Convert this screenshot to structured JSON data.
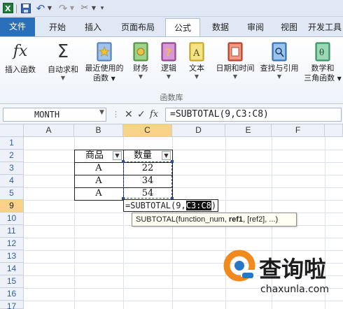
{
  "quick_access": {
    "separator": "|"
  },
  "tabs": [
    {
      "label": "文件"
    },
    {
      "label": "开始"
    },
    {
      "label": "插入"
    },
    {
      "label": "页面布局"
    },
    {
      "label": "公式"
    },
    {
      "label": "数据"
    },
    {
      "label": "审阅"
    },
    {
      "label": "视图"
    },
    {
      "label": "开发工具"
    }
  ],
  "ribbon": {
    "buttons": [
      {
        "label": "插入函数",
        "icon": "fx-icon"
      },
      {
        "label": "自动求和",
        "icon": "sigma-icon"
      },
      {
        "label": "最近使用的",
        "label2": "函数",
        "icon": "book-star-icon"
      },
      {
        "label": "财务",
        "icon": "book-finance-icon"
      },
      {
        "label": "逻辑",
        "icon": "book-question-icon"
      },
      {
        "label": "文本",
        "icon": "book-text-icon"
      },
      {
        "label": "日期和时间",
        "icon": "book-calendar-icon"
      },
      {
        "label": "查找与引用",
        "icon": "book-lookup-icon"
      },
      {
        "label": "数学和",
        "label2": "三角函数",
        "icon": "book-theta-icon"
      }
    ],
    "group_label": "函数库",
    "fx_glyph": "fx",
    "sigma_glyph": "Σ",
    "theta_glyph": "θ"
  },
  "formula_bar": {
    "name_box": "MONTH",
    "cancel_glyph": "✕",
    "enter_glyph": "✓",
    "fx_label": "fx",
    "formula": "=SUBTOTAL(9,C3:C8)"
  },
  "columns": [
    "A",
    "B",
    "C",
    "D",
    "E",
    "F"
  ],
  "rows": [
    "1",
    "2",
    "3",
    "4",
    "5",
    "9",
    "10",
    "11",
    "12",
    "13",
    "14",
    "15",
    "16",
    "17"
  ],
  "table": {
    "headers": [
      "商品",
      "数量"
    ],
    "rows": [
      [
        "A",
        "22"
      ],
      [
        "A",
        "34"
      ],
      [
        "A",
        "54"
      ]
    ]
  },
  "edit_cell": {
    "prefix": "=SUBTOTAL(9,",
    "ref": "C3:C8",
    "suffix": ")"
  },
  "tooltip": {
    "text": "SUBTOTAL(function_num, ",
    "bold": "ref1",
    "rest": ", [ref2], ...)"
  },
  "watermark": {
    "title": "查询啦",
    "url": "chaxunla.com"
  },
  "colors": {
    "file_tab": "#2a6fba",
    "selected_header": "#f9d28a",
    "marquee": "#2b4e9c",
    "watermark_orange": "#f08a1c",
    "watermark_blue": "#2777c7"
  }
}
